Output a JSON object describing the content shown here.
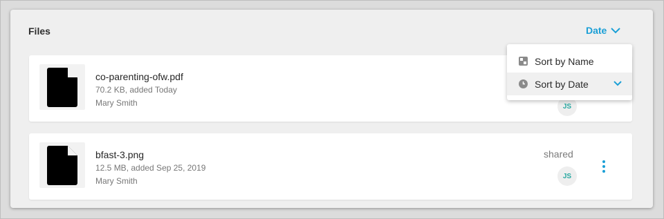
{
  "section": {
    "title": "Files"
  },
  "sort": {
    "current_label": "Date"
  },
  "dropdown": {
    "items": [
      {
        "label": "Sort by Name",
        "icon": "sort-name-icon"
      },
      {
        "label": "Sort by Date",
        "icon": "clock-icon",
        "selected": true
      }
    ]
  },
  "files": [
    {
      "name": "co-parenting-ofw.pdf",
      "meta": "70.2 KB, added Today",
      "owner": "Mary Smith",
      "avatar": "JS"
    },
    {
      "name": "bfast-3.png",
      "meta": "12.5 MB, added Sep 25, 2019",
      "owner": "Mary Smith",
      "shared_label": "shared",
      "avatar": "JS"
    }
  ],
  "colors": {
    "accent": "#1a9fd6",
    "avatar_text": "#27a8a1"
  }
}
